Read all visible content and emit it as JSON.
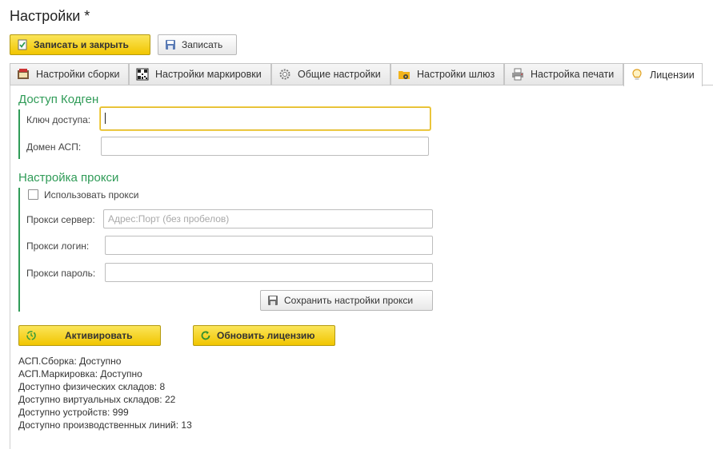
{
  "window": {
    "title": "Настройки *"
  },
  "toolbar": {
    "save_close_label": "Записать и закрыть",
    "save_label": "Записать"
  },
  "tabs": [
    {
      "label": "Настройки сборки",
      "icon": "assembly-icon"
    },
    {
      "label": "Настройки маркировки",
      "icon": "qr-code-icon"
    },
    {
      "label": "Общие настройки",
      "icon": "gear-icon"
    },
    {
      "label": "Настройки шлюз",
      "icon": "folder-gear-icon"
    },
    {
      "label": "Настройка печати",
      "icon": "printer-icon"
    },
    {
      "label": "Лицензии",
      "icon": "lightbulb-icon"
    }
  ],
  "active_tab": "Лицензии",
  "codegen": {
    "title": "Доступ Кодген",
    "access_key_label": "Ключ доступа:",
    "access_key_value": "",
    "domain_label": "Домен АСП:",
    "domain_value": ""
  },
  "proxy": {
    "title": "Настройка прокси",
    "use_proxy_label": "Использовать прокси",
    "use_proxy_checked": false,
    "server_label": "Прокси сервер:",
    "server_placeholder": "Адрес:Порт (без пробелов)",
    "login_label": "Прокси логин:",
    "password_label": "Прокси пароль:",
    "save_button_label": "Сохранить настройки прокси"
  },
  "actions": {
    "activate_label": "Активировать",
    "refresh_label": "Обновить лицензию"
  },
  "status": [
    "АСП.Сборка: Доступно",
    "АСП.Маркировка: Доступно",
    "Доступно физических складов: 8",
    "Доступно виртуальных складов: 22",
    "Доступно устройств: 999",
    "Доступно производственных линий: 13"
  ],
  "colors": {
    "accent_green": "#2f9b57",
    "button_yellow": "#f1c500",
    "focus_border": "#e2b71f"
  }
}
